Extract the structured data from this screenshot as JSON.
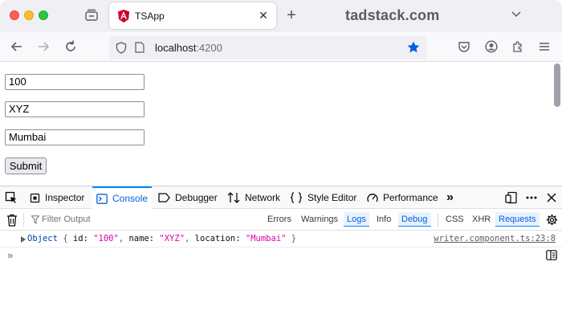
{
  "window": {
    "tab_title": "TSApp",
    "tab_close": "✕",
    "new_tab": "+",
    "watermark": "tadstack.com"
  },
  "navbar": {
    "url_host": "localhost",
    "url_port": ":4200"
  },
  "form": {
    "id_value": "100",
    "name_value": "XYZ",
    "location_value": "Mumbai",
    "submit_label": "Submit"
  },
  "devtools": {
    "tabs": [
      {
        "label": "Inspector",
        "icon": "inspector-icon"
      },
      {
        "label": "Console",
        "icon": "console-icon",
        "active": true
      },
      {
        "label": "Debugger",
        "icon": "debugger-icon"
      },
      {
        "label": "Network",
        "icon": "network-icon"
      },
      {
        "label": "Style Editor",
        "icon": "style-editor-icon"
      },
      {
        "label": "Performance",
        "icon": "performance-icon"
      }
    ],
    "more_tabs": "»",
    "filter_placeholder": "Filter Output",
    "filters": {
      "errors": "Errors",
      "warnings": "Warnings",
      "logs": "Logs",
      "info": "Info",
      "debug": "Debug",
      "css": "CSS",
      "xhr": "XHR",
      "requests": "Requests"
    },
    "log": {
      "object_kw": "Object",
      "open": " { ",
      "k_id": "id: ",
      "v_id": "\"100\"",
      "comma1": ", ",
      "k_name": "name: ",
      "v_name": "\"XYZ\"",
      "comma2": ", ",
      "k_location": "location: ",
      "v_location": "\"Mumbai\"",
      "close": " }",
      "source": "writer.component.ts:23:8"
    },
    "prompt": "»"
  },
  "colors": {
    "accent": "#0a84ff",
    "active_text": "#0060df",
    "string_color": "#dd00a9"
  }
}
